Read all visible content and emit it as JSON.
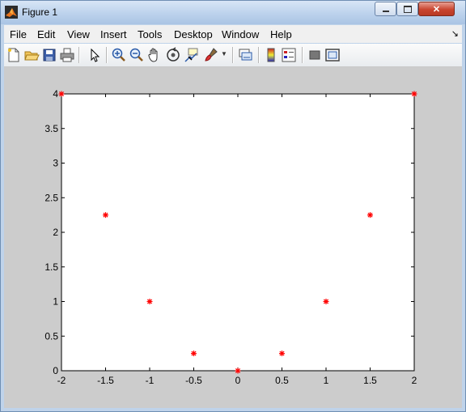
{
  "window": {
    "title": "Figure 1"
  },
  "menu": [
    "File",
    "Edit",
    "View",
    "Insert",
    "Tools",
    "Desktop",
    "Window",
    "Help"
  ],
  "toolbar_icons": [
    "new-figure-icon",
    "open-file-icon",
    "save-icon",
    "print-icon",
    "select-arrow-icon",
    "zoom-in-icon",
    "zoom-out-icon",
    "pan-hand-icon",
    "rotate-3d-icon",
    "data-cursor-icon",
    "brush-icon",
    "link-plot-icon",
    "colorbar-icon",
    "legend-icon",
    "hide-plot-tools-icon",
    "show-plot-tools-icon"
  ],
  "colors": {
    "marker": "#ff0000",
    "figure_bg": "#cccccc",
    "axes_bg": "#ffffff"
  },
  "chart_data": {
    "type": "scatter",
    "marker": "*",
    "x": [
      -2,
      -1.5,
      -1,
      -0.5,
      0,
      0.5,
      1,
      1.5,
      2
    ],
    "y": [
      4,
      2.25,
      1,
      0.25,
      0,
      0.25,
      1,
      2.25,
      4
    ],
    "xlim": [
      -2,
      2
    ],
    "ylim": [
      0,
      4
    ],
    "xticks": [
      "-2",
      "-1.5",
      "-1",
      "-0.5",
      "0",
      "0.5",
      "1",
      "1.5",
      "2"
    ],
    "yticks": [
      "0",
      "0.5",
      "1",
      "1.5",
      "2",
      "2.5",
      "3",
      "3.5",
      "4"
    ],
    "grid": false
  }
}
